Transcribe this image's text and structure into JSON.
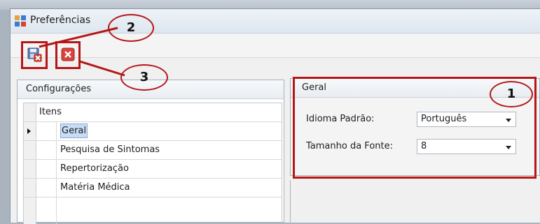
{
  "window": {
    "title": "Preferências"
  },
  "toolbar": {
    "save_icon": "save-icon",
    "cancel_icon": "close-icon"
  },
  "left_panel": {
    "header": "Configurações",
    "column_header": "Itens",
    "items": [
      "Geral",
      "Pesquisa de Sintomas",
      "Repertorização",
      "Matéria Médica"
    ],
    "selected_index": 0
  },
  "right_panel": {
    "header": "Geral",
    "fields": [
      {
        "label": "Idioma Padrão:",
        "value": "Português"
      },
      {
        "label": "Tamanho da Fonte:",
        "value": "8"
      }
    ]
  },
  "annotations": {
    "callout_1": "1",
    "callout_2": "2",
    "callout_3": "3",
    "color": "#b51616"
  }
}
